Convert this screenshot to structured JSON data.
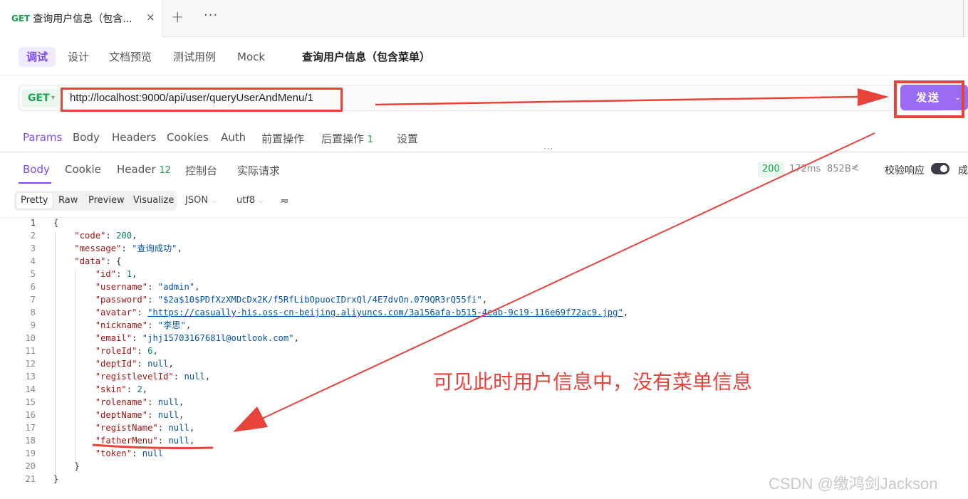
{
  "tab": {
    "method": "GET",
    "title": "查询用户信息（包含...",
    "close": "×",
    "add": "+",
    "more": "···"
  },
  "subnav": {
    "items": [
      "调试",
      "设计",
      "文档预览",
      "测试用例",
      "Mock"
    ],
    "title": "查询用户信息（包含菜单）"
  },
  "request": {
    "method": "GET",
    "url": "http://localhost:9000/api/user/queryUserAndMenu/1",
    "send_label": "发送",
    "tabs": [
      "Params",
      "Body",
      "Headers",
      "Cookies",
      "Auth",
      "前置操作",
      "后置操作",
      "设置"
    ],
    "post_ops_count": "1"
  },
  "response": {
    "tabs": [
      "Body",
      "Cookie",
      "Header",
      "控制台",
      "实际请求"
    ],
    "header_count": "12",
    "status": "200",
    "time": "172ms",
    "size": "852B",
    "validate_label": "校验响应",
    "cut_label": "成",
    "views": [
      "Pretty",
      "Raw",
      "Preview",
      "Visualize"
    ],
    "format": "JSON",
    "encoding": "utf8"
  },
  "code_lines": [
    {
      "n": "1",
      "indent": 0,
      "text": "{"
    },
    {
      "n": "2",
      "indent": 1,
      "key": "\"code\"",
      "val": "200",
      "t": "num",
      "comma": true
    },
    {
      "n": "3",
      "indent": 1,
      "key": "\"message\"",
      "val": "\"查询成功\"",
      "t": "str",
      "comma": true
    },
    {
      "n": "4",
      "indent": 1,
      "key": "\"data\"",
      "val": "{",
      "t": "plain"
    },
    {
      "n": "5",
      "indent": 2,
      "key": "\"id\"",
      "val": "1",
      "t": "num",
      "comma": true
    },
    {
      "n": "6",
      "indent": 2,
      "key": "\"username\"",
      "val": "\"admin\"",
      "t": "str",
      "comma": true
    },
    {
      "n": "7",
      "indent": 2,
      "key": "\"password\"",
      "val": "\"$2a$10$PDfXzXMDcDx2K/f5RfLibOpuocIDrxQl/4E7dvOn.079QR3rQ55fi\"",
      "t": "str",
      "comma": true
    },
    {
      "n": "8",
      "indent": 2,
      "key": "\"avatar\"",
      "val": "\"https://casually-his.oss-cn-beijing.aliyuncs.com/3a156afa-b515-4eab-9c19-116e69f72ac9.jpg\"",
      "t": "link",
      "comma": true
    },
    {
      "n": "9",
      "indent": 2,
      "key": "\"nickname\"",
      "val": "\"李思\"",
      "t": "str",
      "comma": true
    },
    {
      "n": "10",
      "indent": 2,
      "key": "\"email\"",
      "val": "\"jhj15703167681l@outlook.com\"",
      "t": "str",
      "comma": true
    },
    {
      "n": "11",
      "indent": 2,
      "key": "\"roleId\"",
      "val": "6",
      "t": "num",
      "comma": true
    },
    {
      "n": "12",
      "indent": 2,
      "key": "\"deptId\"",
      "val": "null",
      "t": "nul",
      "comma": true
    },
    {
      "n": "13",
      "indent": 2,
      "key": "\"registlevelId\"",
      "val": "null",
      "t": "nul",
      "comma": true
    },
    {
      "n": "14",
      "indent": 2,
      "key": "\"skin\"",
      "val": "2",
      "t": "num",
      "comma": true
    },
    {
      "n": "15",
      "indent": 2,
      "key": "\"rolename\"",
      "val": "null",
      "t": "nul",
      "comma": true
    },
    {
      "n": "16",
      "indent": 2,
      "key": "\"deptName\"",
      "val": "null",
      "t": "nul",
      "comma": true
    },
    {
      "n": "17",
      "indent": 2,
      "key": "\"registName\"",
      "val": "null",
      "t": "nul",
      "comma": true
    },
    {
      "n": "18",
      "indent": 2,
      "key": "\"fatherMenu\"",
      "val": "null",
      "t": "nul",
      "comma": true
    },
    {
      "n": "19",
      "indent": 2,
      "key": "\"token\"",
      "val": "null",
      "t": "nul"
    },
    {
      "n": "20",
      "indent": 1,
      "text": "}"
    },
    {
      "n": "21",
      "indent": 0,
      "text": "}"
    }
  ],
  "annotation": "可见此时用户信息中，没有菜单信息",
  "watermark": "CSDN @缴鸿剑Jackson",
  "colors": {
    "accent": "#7d4cf0",
    "send": "#9a6cf3",
    "get": "#17a34a",
    "annotation_red": "#e8433b"
  }
}
